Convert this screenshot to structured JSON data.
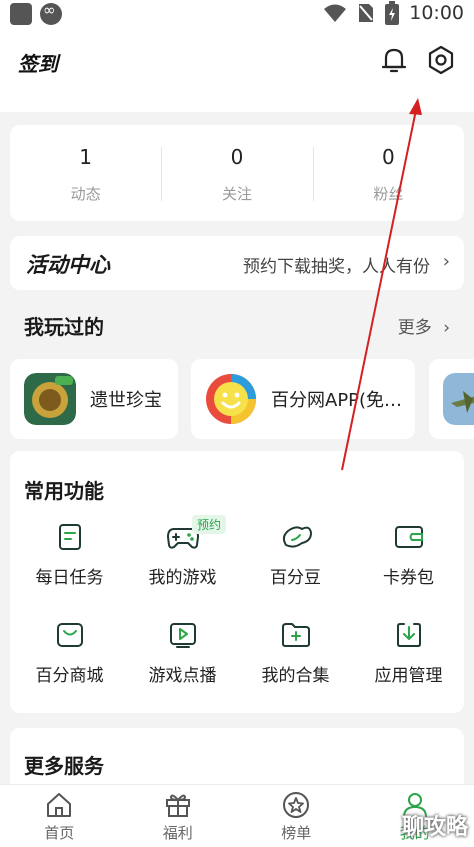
{
  "status_bar": {
    "time": "10:00",
    "icons": [
      "notification-icon",
      "infinity-icon",
      "wifi-icon",
      "no-sim-icon",
      "battery-icon"
    ]
  },
  "header": {
    "logo_text": "签到",
    "icons": [
      "bell-icon",
      "gear-icon"
    ]
  },
  "stats": [
    {
      "count": "1",
      "label": "动态"
    },
    {
      "count": "0",
      "label": "关注"
    },
    {
      "count": "0",
      "label": "粉丝"
    }
  ],
  "activity": {
    "title": "活动中心",
    "text": "预约下载抽奖，人人有份"
  },
  "played": {
    "title": "我玩过的",
    "more": "更多",
    "games": [
      {
        "name": "遗世珍宝",
        "icon": "treasure-game-icon"
      },
      {
        "name": "百分网APP(免…",
        "icon": "smiley-app-icon"
      },
      {
        "name": "",
        "icon": "warplane-game-icon"
      }
    ]
  },
  "common": {
    "title": "常用功能",
    "badge": "预约",
    "items": [
      {
        "label": "每日任务",
        "icon": "task-icon"
      },
      {
        "label": "我的游戏",
        "icon": "gamepad-icon"
      },
      {
        "label": "百分豆",
        "icon": "bean-icon"
      },
      {
        "label": "卡券包",
        "icon": "wallet-icon"
      },
      {
        "label": "百分商城",
        "icon": "shop-icon"
      },
      {
        "label": "游戏点播",
        "icon": "play-icon"
      },
      {
        "label": "我的合集",
        "icon": "folder-icon"
      },
      {
        "label": "应用管理",
        "icon": "download-icon"
      }
    ]
  },
  "more_services": {
    "title": "更多服务"
  },
  "bottom_nav": [
    {
      "label": "首页",
      "icon": "home-icon"
    },
    {
      "label": "福利",
      "icon": "gift-icon"
    },
    {
      "label": "榜单",
      "icon": "star-icon"
    },
    {
      "label": "我的",
      "icon": "user-icon",
      "active": true
    }
  ],
  "watermark": "聊攻略",
  "colors": {
    "accent": "#2aa54a",
    "annotation": "#d42020",
    "background": "#f3f3f3"
  }
}
